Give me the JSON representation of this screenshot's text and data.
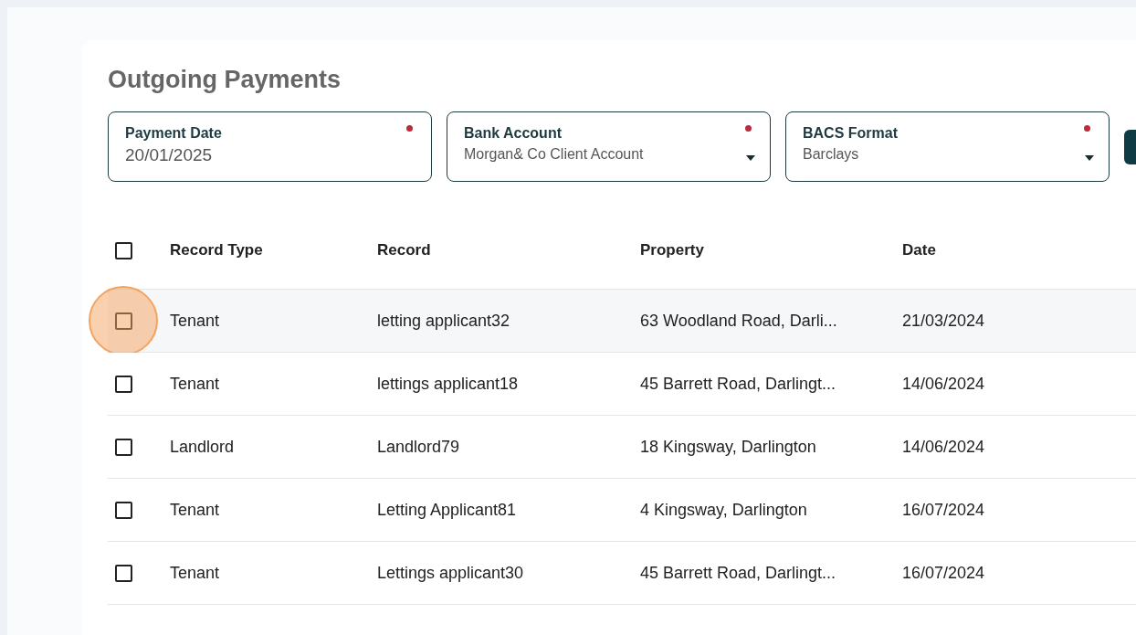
{
  "title": "Outgoing Payments",
  "fields": [
    {
      "kind": "date",
      "label": "Payment Date",
      "value": "20/01/2025",
      "required": true
    },
    {
      "kind": "select",
      "label": "Bank Account",
      "value": "Morgan& Co Client Account",
      "required": true
    },
    {
      "kind": "select",
      "label": "BACS Format",
      "value": "Barclays",
      "required": true
    }
  ],
  "table": {
    "columns": [
      "Record Type",
      "Record",
      "Property",
      "Date"
    ],
    "header_checked": false,
    "rows": [
      {
        "cells": [
          "Tenant",
          "letting applicant32",
          "63 Woodland Road, Darli...",
          "21/03/2024"
        ],
        "checked": false,
        "highlighted": true
      },
      {
        "cells": [
          "Tenant",
          "lettings applicant18",
          "45 Barrett Road, Darlingt...",
          "14/06/2024"
        ],
        "checked": false,
        "highlighted": false
      },
      {
        "cells": [
          "Landlord",
          "Landlord79",
          "18 Kingsway, Darlington",
          "14/06/2024"
        ],
        "checked": false,
        "highlighted": false
      },
      {
        "cells": [
          "Tenant",
          "Letting Applicant81",
          "4 Kingsway, Darlington",
          "16/07/2024"
        ],
        "checked": false,
        "highlighted": false
      },
      {
        "cells": [
          "Tenant",
          "Lettings applicant30",
          "45 Barrett Road, Darlingt...",
          "16/07/2024"
        ],
        "checked": false,
        "highlighted": false
      }
    ]
  }
}
